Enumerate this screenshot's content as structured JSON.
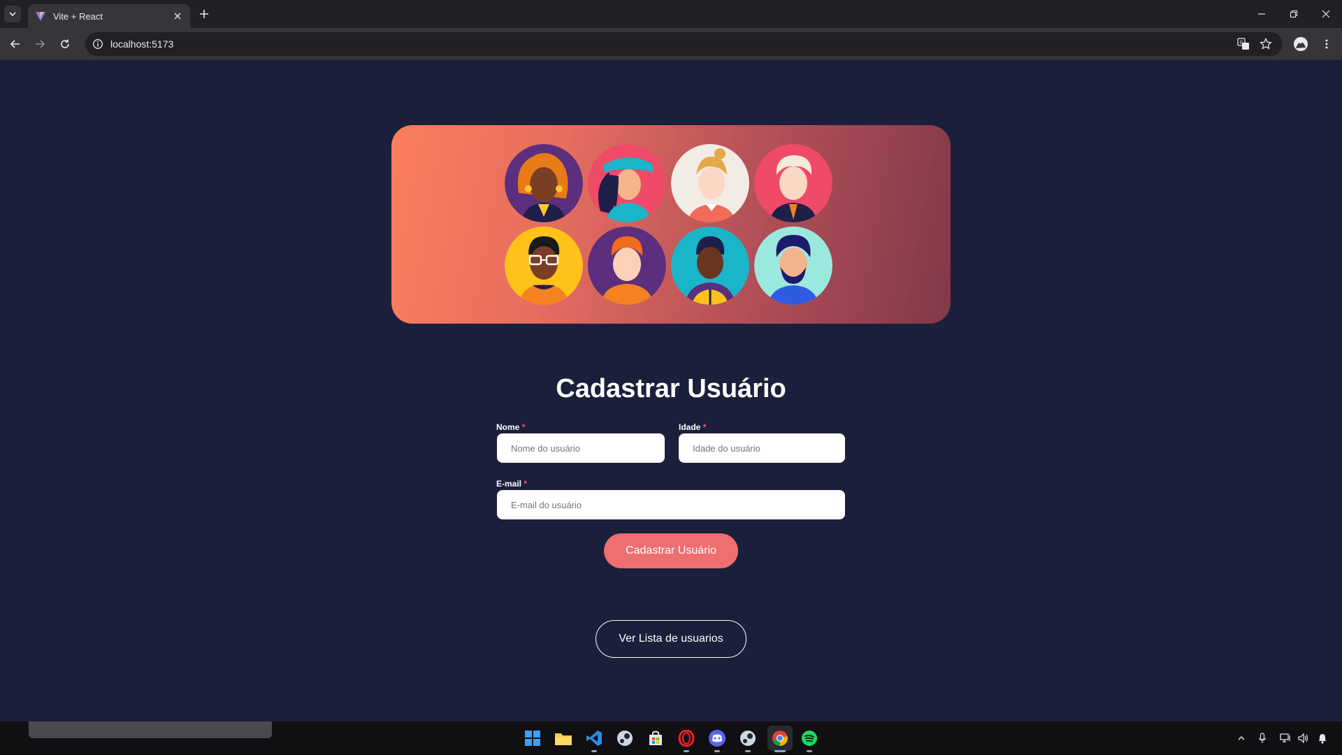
{
  "browser": {
    "tab_title": "Vite + React",
    "url": "localhost:5173"
  },
  "form": {
    "title": "Cadastrar Usuário",
    "required_mark": "*",
    "name_label": "Nome",
    "name_placeholder": "Nome do usuário",
    "age_label": "Idade",
    "age_placeholder": "Idade do usuário",
    "email_label": "E-mail",
    "email_placeholder": "E-mail do usuário",
    "submit_label": "Cadastrar Usuário"
  },
  "list_button_label": "Ver Lista de usuarios",
  "colors": {
    "page_background": "#1b1f3b",
    "hero_gradient_start": "#fb7e5d",
    "hero_gradient_end": "#823848",
    "submit_button": "#ef6e6f",
    "required_mark": "#ff4d6d"
  },
  "hero_avatars": [
    "avatar-woman-curly-orange-hair",
    "avatar-woman-blue-cap",
    "avatar-woman-blonde-ponytail",
    "avatar-man-white-hair",
    "avatar-man-glasses",
    "avatar-man-orange-hair",
    "avatar-man-yellow-jacket",
    "avatar-man-beard"
  ],
  "taskbar_icons": [
    "windows-start-icon",
    "file-explorer-icon",
    "vscode-icon",
    "steam-icon",
    "microsoft-store-icon",
    "opera-icon",
    "discord-icon",
    "steam-icon",
    "chrome-icon",
    "spotify-icon"
  ]
}
